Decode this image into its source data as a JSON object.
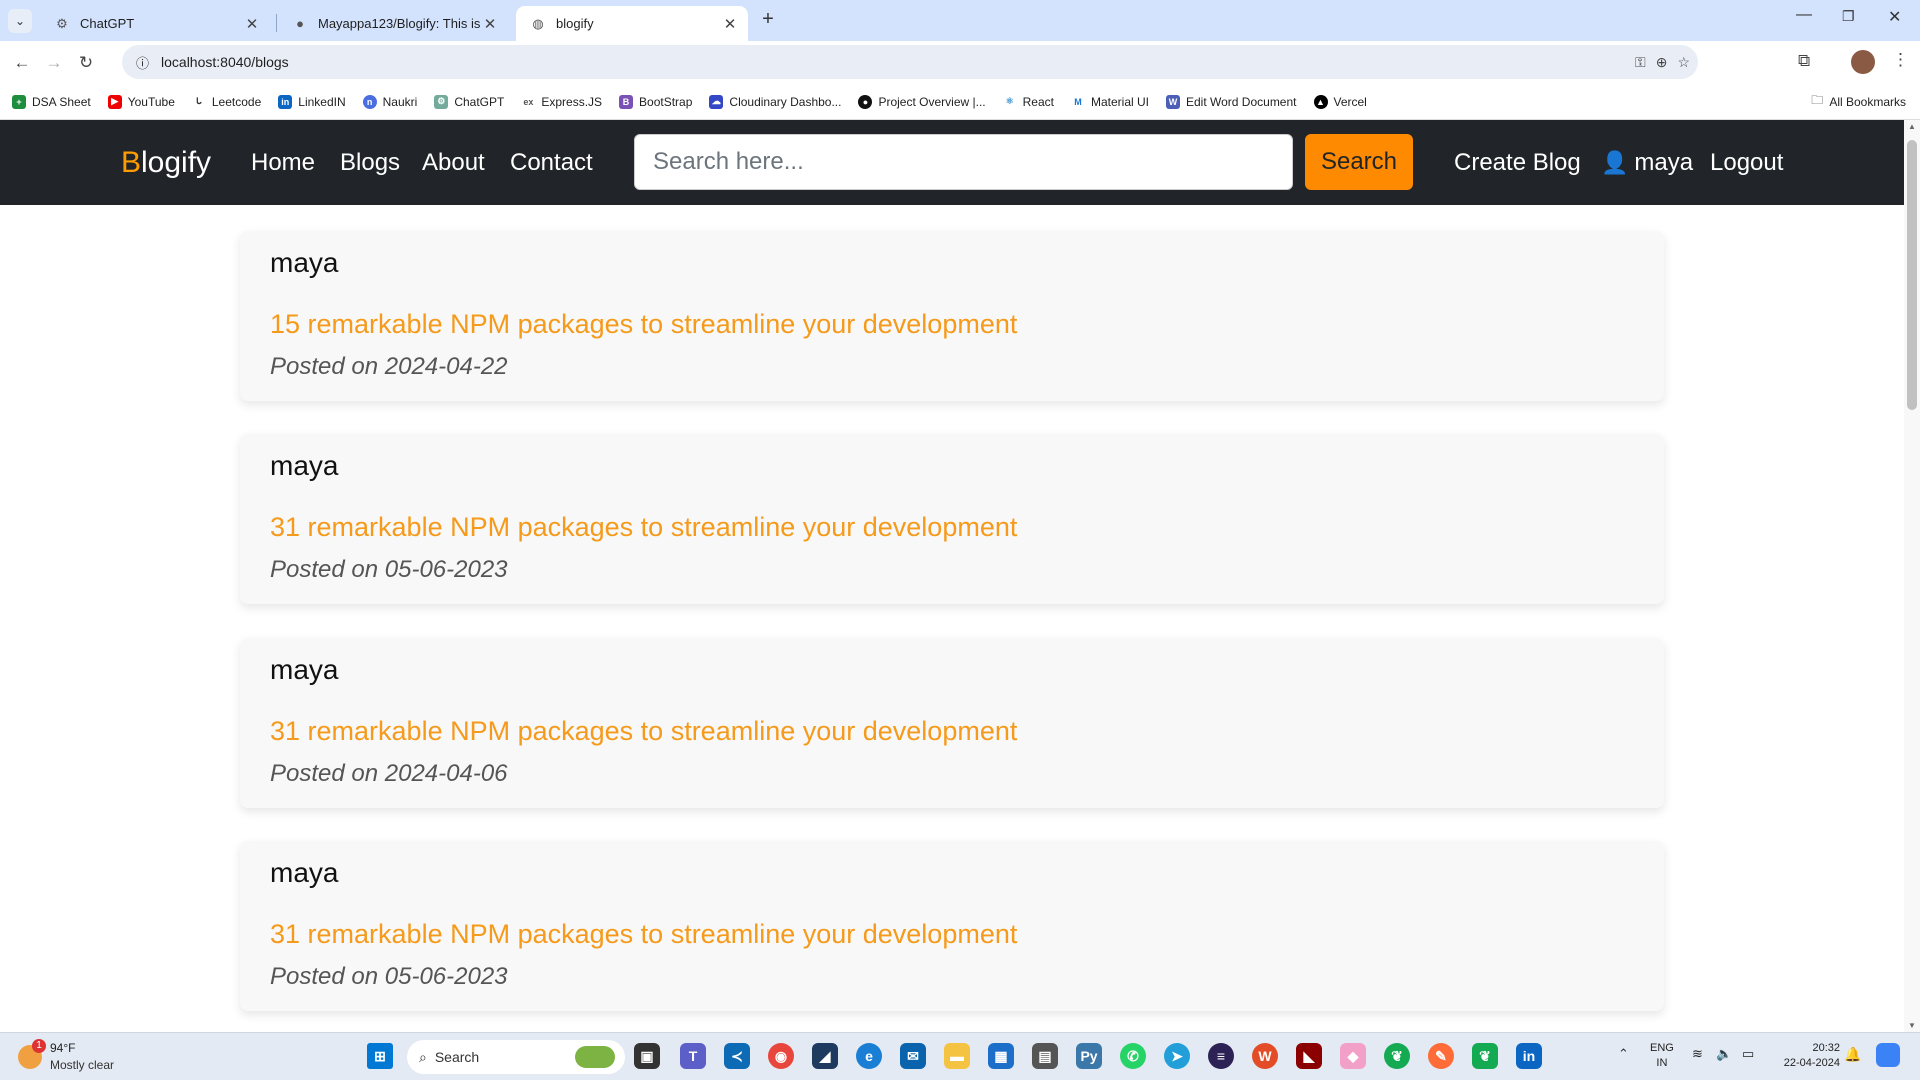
{
  "browser": {
    "tabs": [
      {
        "title": "ChatGPT",
        "icon": "chatgpt-icon"
      },
      {
        "title": "Mayappa123/Blogify: This is bl",
        "icon": "github-icon"
      },
      {
        "title": "blogify",
        "icon": "globe-icon"
      }
    ],
    "url": "localhost:8040/blogs",
    "bookmarks": [
      "DSA Sheet",
      "YouTube",
      "Leetcode",
      "LinkedIN",
      "Naukri",
      "ChatGPT",
      "Express.JS",
      "BootStrap",
      "Cloudinary Dashbo...",
      "Project Overview |...",
      "React",
      "Material UI",
      "Edit Word Document",
      "Vercel"
    ],
    "all_bookmarks": "All Bookmarks"
  },
  "nav": {
    "brand_first": "B",
    "brand_rest": "logify",
    "links": [
      "Home",
      "Blogs",
      "About",
      "Contact"
    ],
    "search_placeholder": "Search here...",
    "search_button": "Search",
    "create": "Create Blog",
    "user": "maya",
    "logout": "Logout",
    "accent": "#fd8a00"
  },
  "posts": [
    {
      "author": "maya",
      "title": "15 remarkable NPM packages to streamline your development",
      "date": "Posted on 2024-04-22"
    },
    {
      "author": "maya",
      "title": "31 remarkable NPM packages to streamline your development",
      "date": "Posted on 05-06-2023"
    },
    {
      "author": "maya",
      "title": "31 remarkable NPM packages to streamline your development",
      "date": "Posted on 2024-04-06"
    },
    {
      "author": "maya",
      "title": "31 remarkable NPM packages to streamline your development",
      "date": "Posted on 05-06-2023"
    }
  ],
  "taskbar": {
    "temp": "94°F",
    "weather": "Mostly clear",
    "badge": "1",
    "search": "Search",
    "lang1": "ENG",
    "lang2": "IN",
    "time": "20:32",
    "date": "22-04-2024"
  }
}
